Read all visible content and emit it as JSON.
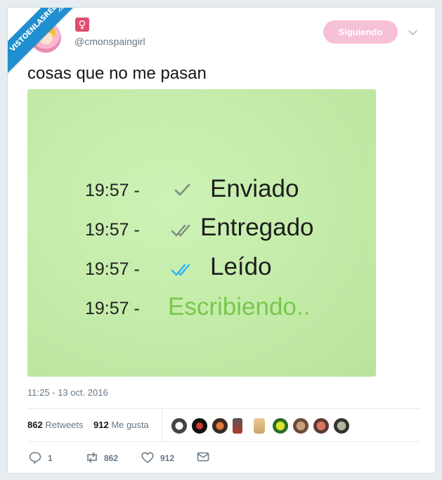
{
  "watermark": {
    "text": "VISTOENLASREDES",
    "suffix": ".com"
  },
  "author": {
    "handle": "@cmonspaingirl",
    "badge_glyph": "♀"
  },
  "follow_button": {
    "label": "Siguiendo",
    "color": "#f6c0d6"
  },
  "tweet": {
    "text": "cosas que no me pasan"
  },
  "image_content": {
    "lines": [
      {
        "time": "19:57 -",
        "status": "Enviado",
        "check": "single-grey-check"
      },
      {
        "time": "19:57 -",
        "status": "Entregado",
        "check": "double-grey-check"
      },
      {
        "time": "19:57 -",
        "status": "Leído",
        "check": "double-blue-check"
      },
      {
        "time": "19:57 -",
        "status": "Escribiendo..",
        "check": "none"
      }
    ],
    "background": "#c6eeab",
    "typing_color": "#78c84b",
    "read_check_color": "#34b7f1"
  },
  "timestamp": "11:25 - 13 oct. 2016",
  "stats": {
    "retweets_count": "862",
    "retweets_label": "Retweets",
    "likes_count": "912",
    "likes_label": "Me gusta"
  },
  "likers_count": 9,
  "actions": {
    "replies": "1",
    "retweets": "862",
    "likes": "912"
  }
}
